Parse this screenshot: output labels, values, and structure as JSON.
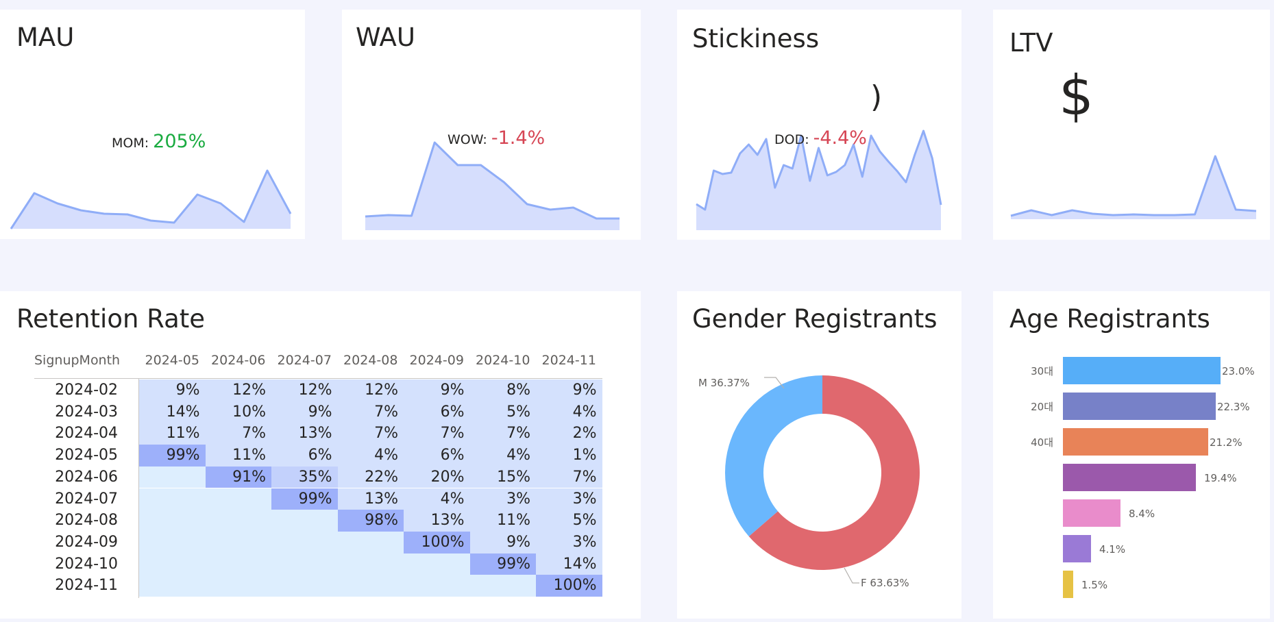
{
  "kpis": {
    "mau": {
      "title": "MAU",
      "label": "MOM:",
      "value": "205%"
    },
    "wau": {
      "title": "WAU",
      "label": "WOW:",
      "value": "-1.4%"
    },
    "stickiness": {
      "title": "Stickiness",
      "label": "DOD:",
      "value": "-4.4%",
      "clipped_glyph": ")"
    },
    "ltv": {
      "title": "LTV",
      "value": "$"
    }
  },
  "colors": {
    "spark_line": "#8fadf7",
    "spark_fill": "#d6defd",
    "positive": "#1aab40",
    "negative": "#d64554"
  },
  "retention": {
    "title": "Retention Rate",
    "corner_header": "SignupMonth",
    "columns": [
      "2024-05",
      "2024-06",
      "2024-07",
      "2024-08",
      "2024-09",
      "2024-10",
      "2024-11"
    ],
    "rows": [
      {
        "label": "2024-02",
        "values": [
          "9%",
          "12%",
          "12%",
          "12%",
          "9%",
          "8%",
          "9%"
        ]
      },
      {
        "label": "2024-03",
        "values": [
          "14%",
          "10%",
          "9%",
          "7%",
          "6%",
          "5%",
          "4%"
        ]
      },
      {
        "label": "2024-04",
        "values": [
          "11%",
          "7%",
          "13%",
          "7%",
          "7%",
          "7%",
          "2%"
        ]
      },
      {
        "label": "2024-05",
        "values": [
          "99%",
          "11%",
          "6%",
          "4%",
          "6%",
          "4%",
          "1%"
        ]
      },
      {
        "label": "2024-06",
        "values": [
          "",
          "91%",
          "35%",
          "22%",
          "20%",
          "15%",
          "7%"
        ]
      },
      {
        "label": "2024-07",
        "values": [
          "",
          "",
          "99%",
          "13%",
          "4%",
          "3%",
          "3%"
        ]
      },
      {
        "label": "2024-08",
        "values": [
          "",
          "",
          "",
          "98%",
          "13%",
          "11%",
          "5%"
        ]
      },
      {
        "label": "2024-09",
        "values": [
          "",
          "",
          "",
          "",
          "100%",
          "9%",
          "3%"
        ]
      },
      {
        "label": "2024-10",
        "values": [
          "",
          "",
          "",
          "",
          "",
          "99%",
          "14%"
        ]
      },
      {
        "label": "2024-11",
        "values": [
          "",
          "",
          "",
          "",
          "",
          "",
          "100%"
        ]
      }
    ]
  },
  "gender": {
    "title": "Gender Registrants",
    "label_m": "M 36.37%",
    "label_f": "F 63.63%"
  },
  "age": {
    "title": "Age Registrants"
  },
  "chart_data": [
    {
      "type": "area",
      "name": "MAU sparkline",
      "values": [
        0,
        52,
        37,
        27,
        22,
        21,
        12,
        9,
        50,
        37,
        10,
        85,
        22
      ],
      "ylim": [
        0,
        100
      ]
    },
    {
      "type": "area",
      "name": "WAU sparkline",
      "values": [
        20,
        22,
        21,
        128,
        95,
        95,
        70,
        38,
        30,
        33,
        17,
        17
      ],
      "ylim": [
        0,
        140
      ]
    },
    {
      "type": "area",
      "name": "Stickiness sparkline",
      "values": [
        38,
        30,
        87,
        82,
        84,
        112,
        125,
        110,
        133,
        62,
        95,
        90,
        138,
        72,
        120,
        80,
        85,
        95,
        125,
        78,
        138,
        115,
        100,
        86,
        70,
        110,
        145,
        105,
        37
      ],
      "ylim": [
        0,
        160
      ]
    },
    {
      "type": "area",
      "name": "LTV sparkline",
      "values": [
        5,
        13,
        6,
        13,
        8,
        6,
        7,
        6,
        6,
        7,
        92,
        14,
        12
      ],
      "ylim": [
        0,
        110
      ]
    },
    {
      "type": "heatmap",
      "title": "Retention Rate",
      "x": [
        "2024-05",
        "2024-06",
        "2024-07",
        "2024-08",
        "2024-09",
        "2024-10",
        "2024-11"
      ],
      "y": [
        "2024-02",
        "2024-03",
        "2024-04",
        "2024-05",
        "2024-06",
        "2024-07",
        "2024-08",
        "2024-09",
        "2024-10",
        "2024-11"
      ],
      "values": [
        [
          9,
          12,
          12,
          12,
          9,
          8,
          9
        ],
        [
          14,
          10,
          9,
          7,
          6,
          5,
          4
        ],
        [
          11,
          7,
          13,
          7,
          7,
          7,
          2
        ],
        [
          99,
          11,
          6,
          4,
          6,
          4,
          1
        ],
        [
          null,
          91,
          35,
          22,
          20,
          15,
          7
        ],
        [
          null,
          null,
          99,
          13,
          4,
          3,
          3
        ],
        [
          null,
          null,
          null,
          98,
          13,
          11,
          5
        ],
        [
          null,
          null,
          null,
          null,
          100,
          9,
          3
        ],
        [
          null,
          null,
          null,
          null,
          null,
          99,
          14
        ],
        [
          null,
          null,
          null,
          null,
          null,
          null,
          100
        ]
      ]
    },
    {
      "type": "pie",
      "title": "Gender Registrants",
      "donut": true,
      "slices": [
        {
          "label": "F",
          "value": 63.63,
          "color": "#e0686e"
        },
        {
          "label": "M",
          "value": 36.37,
          "color": "#6ab7fd"
        }
      ]
    },
    {
      "type": "bar",
      "orientation": "horizontal",
      "title": "Age Registrants",
      "categories": [
        "30대",
        "20대",
        "40대",
        "",
        "",
        "",
        ""
      ],
      "values": [
        23.0,
        22.3,
        21.2,
        19.4,
        8.4,
        4.1,
        1.5
      ],
      "labels": [
        "23.0%",
        "22.3%",
        "21.2%",
        "19.4%",
        "8.4%",
        "4.1%",
        "1.5%"
      ],
      "colors": [
        "#56aef8",
        "#7781c8",
        "#e88358",
        "#9b59ab",
        "#e98ccb",
        "#9a7ad6",
        "#e6c244"
      ]
    }
  ]
}
